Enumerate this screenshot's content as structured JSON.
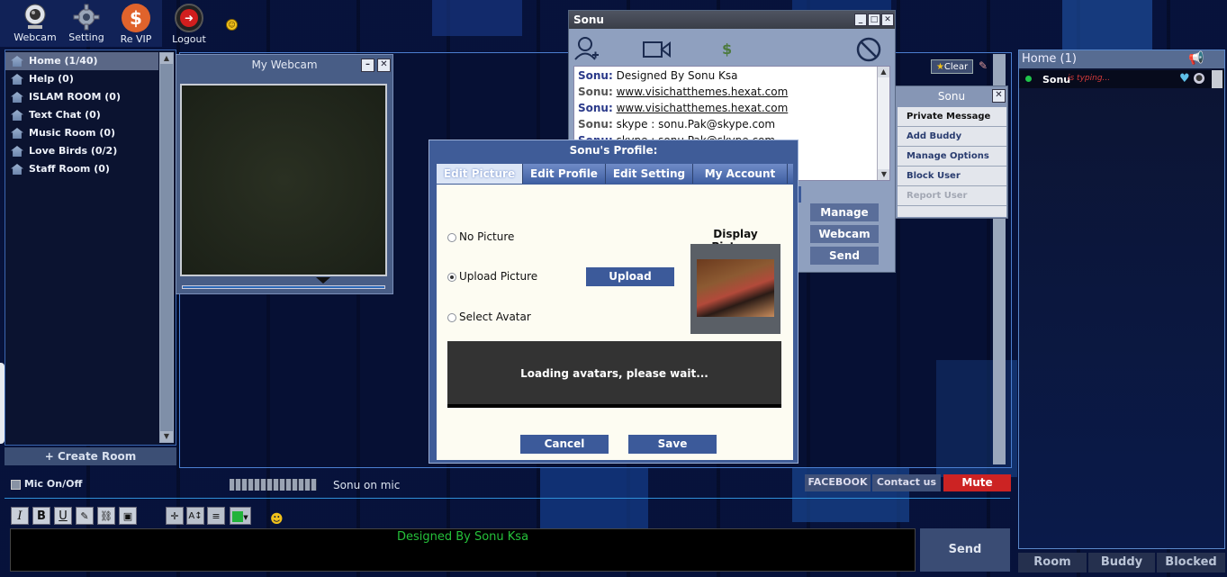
{
  "toolbar": {
    "items": [
      {
        "label": "Webcam",
        "icon": "webcam-icon"
      },
      {
        "label": "Setting",
        "icon": "gear-icon"
      },
      {
        "label": "Re VIP",
        "icon": "dollar-icon"
      },
      {
        "label": "Logout",
        "icon": "logout-icon"
      }
    ],
    "smiley_icon": "smiley-icon"
  },
  "rooms": {
    "items": [
      {
        "label": "Home (1/40)",
        "selected": true
      },
      {
        "label": "Help (0)",
        "selected": false
      },
      {
        "label": "ISLAM ROOM (0)",
        "selected": false
      },
      {
        "label": "Text Chat (0)",
        "selected": false
      },
      {
        "label": "Music Room (0)",
        "selected": false
      },
      {
        "label": "Love Birds (0/2)",
        "selected": false
      },
      {
        "label": "Staff Room (0)",
        "selected": false
      }
    ],
    "create_label": "+ Create Room"
  },
  "webcam_window": {
    "title": "My Webcam"
  },
  "pm_window": {
    "title": "Sonu",
    "messages": [
      {
        "name": "Sonu:",
        "text": "Designed By Sonu Ksa",
        "link": false
      },
      {
        "name": "Sonu:",
        "text": "www.visichatthemes.hexat.com",
        "link": true
      },
      {
        "name": "Sonu:",
        "text": "www.visichatthemes.hexat.com",
        "link": true
      },
      {
        "name": "Sonu:",
        "text": "skype : sonu.Pak@skype.com",
        "link": false
      },
      {
        "name": "Sonu:",
        "text": "skype : sonu.Pak@skype.com",
        "link": false
      }
    ],
    "buttons": {
      "manage": "Manage",
      "webcam": "Webcam",
      "send": "Send"
    }
  },
  "main_chat": {
    "clear_label": "Clear"
  },
  "user_menu": {
    "title": "Sonu",
    "items": [
      {
        "label": "Private Message",
        "enabled": true
      },
      {
        "label": "Add Buddy",
        "enabled": true
      },
      {
        "label": "Manage Options",
        "enabled": true
      },
      {
        "label": "Block User",
        "enabled": true
      },
      {
        "label": "Report User",
        "enabled": false
      }
    ]
  },
  "profile_dialog": {
    "title": "Sonu's Profile:",
    "tabs": [
      "Edit Picture",
      "Edit Profile",
      "Edit Setting",
      "My Account"
    ],
    "active_tab": "Edit Picture",
    "options": [
      {
        "label": "No Picture",
        "checked": false
      },
      {
        "label": "Upload Picture",
        "checked": true
      },
      {
        "label": "Select Avatar",
        "checked": false
      }
    ],
    "upload_label": "Upload",
    "display_picture_label": "Display Picture:",
    "loading_text": "Loading avatars, please wait...",
    "cancel_label": "Cancel",
    "save_label": "Save"
  },
  "user_list": {
    "title": "Home (1)",
    "users": [
      {
        "name": "Sonu",
        "status": "is typing..."
      }
    ],
    "tabs": [
      "Room",
      "Buddy",
      "Blocked"
    ]
  },
  "mic_bar": {
    "mic_label": "Mic On/Off",
    "on_mic_text": "Sonu on mic",
    "facebook_label": "FACEBOOK",
    "contact_label": "Contact us",
    "mute_label": "Mute"
  },
  "input": {
    "text": "Designed By Sonu Ksa",
    "send_label": "Send",
    "format_buttons": [
      "I",
      "B",
      "U"
    ]
  },
  "colors": {
    "accent_blue": "#3c5a9a",
    "mute_red": "#cc2323",
    "input_text_green": "#25c13a",
    "status_green": "#1fc44a",
    "typing_red": "#d43a3a"
  }
}
